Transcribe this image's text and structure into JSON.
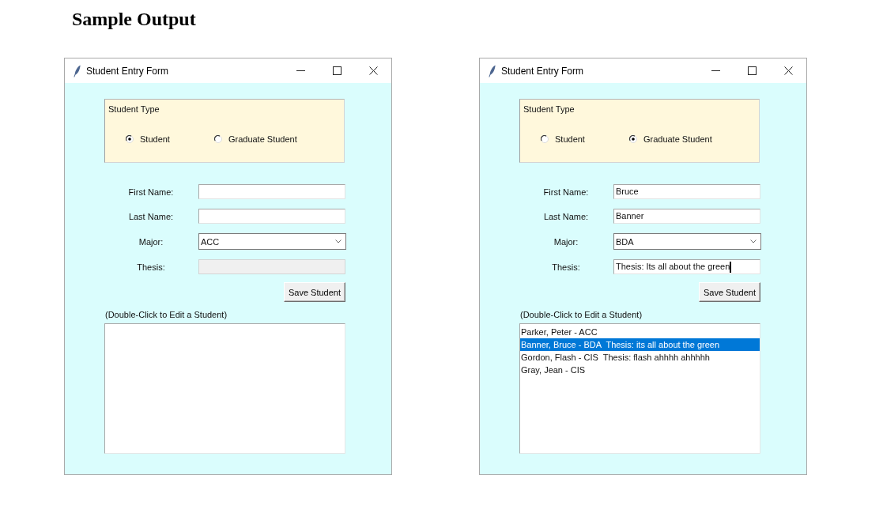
{
  "heading": "Sample Output",
  "windows": [
    {
      "title": "Student Entry Form",
      "student_type": {
        "title": "Student Type",
        "options": [
          {
            "label": "Student",
            "selected": true
          },
          {
            "label": "Graduate Student",
            "selected": false
          }
        ]
      },
      "fields": [
        {
          "label": "First Name:",
          "kind": "entry",
          "disabled": false,
          "focused": false
        },
        {
          "label": "Last Name:",
          "kind": "entry",
          "disabled": false,
          "focused": false
        },
        {
          "label": "Major:",
          "kind": "combobox",
          "value": "ACC",
          "disabled": false,
          "focused": false
        },
        {
          "label": "Thesis:",
          "kind": "entry",
          "disabled": true,
          "focused": false
        }
      ],
      "save_button": "Save Student",
      "list_hint": "(Double-Click to Edit a Student)"
    },
    {
      "title": "Student Entry Form",
      "student_type": {
        "title": "Student Type",
        "options": [
          {
            "label": "Student",
            "selected": false
          },
          {
            "label": "Graduate Student",
            "selected": true
          }
        ]
      },
      "fields": [
        {
          "label": "First Name:",
          "kind": "entry",
          "value": "Bruce",
          "disabled": false,
          "focused": false
        },
        {
          "label": "Last Name:",
          "kind": "entry",
          "value": "Banner",
          "disabled": false,
          "focused": false
        },
        {
          "label": "Major:",
          "kind": "combobox",
          "value": "BDA",
          "disabled": false,
          "focused": false
        },
        {
          "label": "Thesis:",
          "kind": "entry",
          "value": "Thesis: Its all about the green",
          "disabled": false,
          "focused": true
        }
      ],
      "save_button": "Save Student",
      "list_hint": "(Double-Click to Edit a Student)",
      "list_items": [
        {
          "text": "Parker, Peter - ACC",
          "selected": false
        },
        {
          "text": "Banner, Bruce - BDA  Thesis: its all about the green",
          "selected": true
        },
        {
          "text": "Gordon, Flash - CIS  Thesis: flash ahhhh ahhhhh",
          "selected": false
        },
        {
          "text": "Gray, Jean - CIS",
          "selected": false
        }
      ]
    }
  ]
}
